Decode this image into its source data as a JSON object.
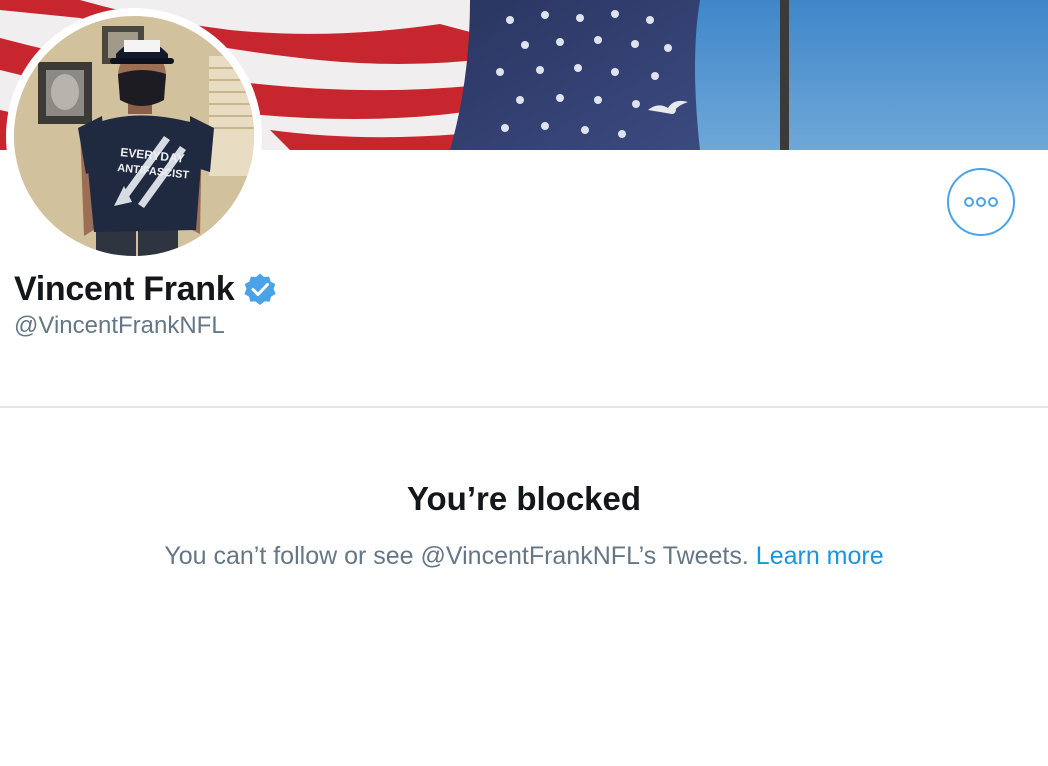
{
  "profile": {
    "display_name": "Vincent Frank",
    "handle": "@VincentFrankNFL",
    "verified": true,
    "shirt_text_line1": "EVERYDAY",
    "shirt_text_line2": "ANTIFASCIST"
  },
  "blocked": {
    "title": "You’re blocked",
    "message": "You can’t follow or see @VincentFrankNFL’s Tweets.",
    "link_label": "Learn more"
  },
  "icons": {
    "more": "more-options-icon",
    "verified": "verified-badge-icon"
  },
  "colors": {
    "accent": "#1b95e0",
    "verified": "#4aa3e8",
    "text_primary": "#14171a",
    "text_secondary": "#657786",
    "divider": "#e1e8ed"
  }
}
